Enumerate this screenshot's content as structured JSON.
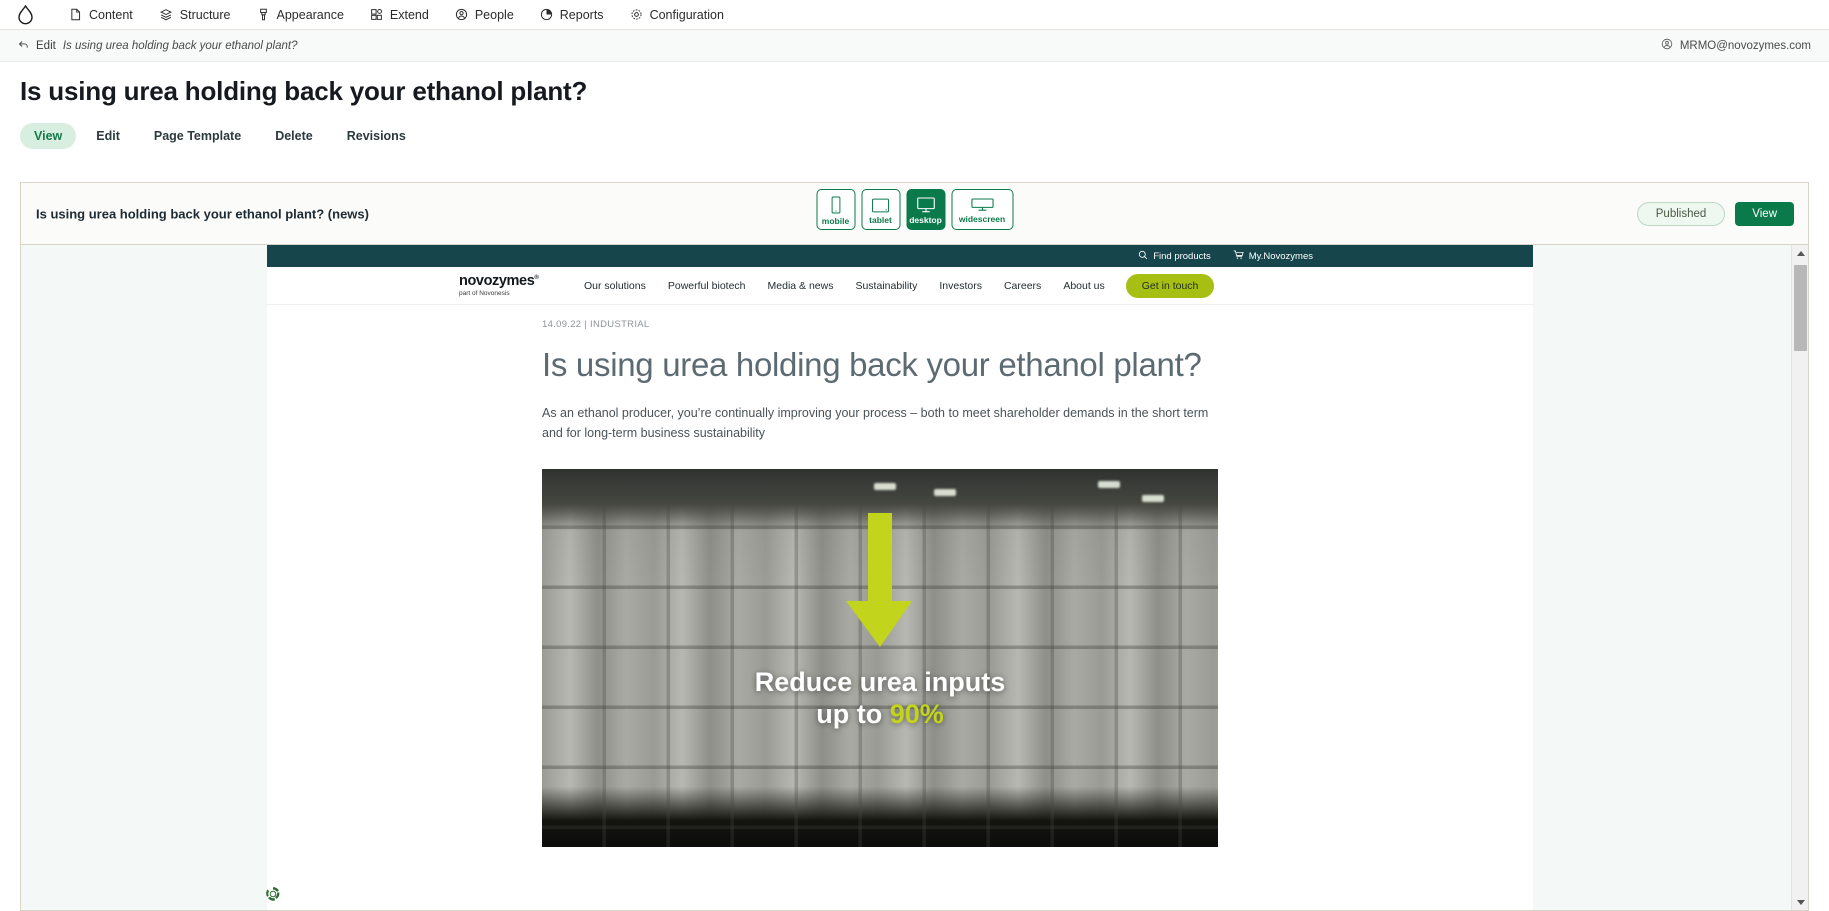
{
  "admin_toolbar": {
    "logo_name": "drupal-drop-logo",
    "items": [
      {
        "label": "Content",
        "icon": "file-icon"
      },
      {
        "label": "Structure",
        "icon": "layers-icon"
      },
      {
        "label": "Appearance",
        "icon": "paintbrush-icon"
      },
      {
        "label": "Extend",
        "icon": "puzzle-icon"
      },
      {
        "label": "People",
        "icon": "person-circle-icon"
      },
      {
        "label": "Reports",
        "icon": "pie-chart-icon"
      },
      {
        "label": "Configuration",
        "icon": "gear-icon"
      }
    ]
  },
  "edit_bar": {
    "back_icon": "back-arrow-icon",
    "edit_word": "Edit",
    "edit_title": "Is using urea holding back your ethanol plant?",
    "account_icon": "account-circle-icon",
    "account_email": "MRMO@novozymes.com"
  },
  "page": {
    "title": "Is using urea holding back your ethanol plant?",
    "tabs": [
      {
        "label": "View",
        "active": true
      },
      {
        "label": "Edit",
        "active": false
      },
      {
        "label": "Page Template",
        "active": false
      },
      {
        "label": "Delete",
        "active": false
      },
      {
        "label": "Revisions",
        "active": false
      }
    ]
  },
  "preview": {
    "label": "Is using urea holding back your ethanol plant? (news)",
    "devices": [
      {
        "label": "mobile",
        "icon": "phone-icon",
        "active": false
      },
      {
        "label": "tablet",
        "icon": "tablet-icon",
        "active": false
      },
      {
        "label": "desktop",
        "icon": "monitor-icon",
        "active": true
      },
      {
        "label": "widescreen",
        "icon": "widescreen-monitor-icon",
        "active": false
      }
    ],
    "status": "Published",
    "view_button": "View"
  },
  "site": {
    "utility_links": [
      {
        "label": "Find products",
        "icon": "search-icon"
      },
      {
        "label": "My.Novozymes",
        "icon": "cart-icon"
      }
    ],
    "logo": {
      "wordmark": "novozymes",
      "trademark": "®",
      "tagline": "part of Novonesis"
    },
    "nav": [
      "Our solutions",
      "Powerful biotech",
      "Media & news",
      "Sustainability",
      "Investors",
      "Careers",
      "About us"
    ],
    "cta": "Get in touch",
    "article": {
      "meta": "14.09.22 | INDUSTRIAL",
      "headline": "Is using urea holding back your ethanol plant?",
      "lede": "As an ethanol producer, you’re continually improving your process – both to meet shareholder demands in the short term and for long-term business sustainability",
      "hero": {
        "alt": "Stacked white bulk bags in a warehouse with a large green downward arrow",
        "overlay_line1": "Reduce urea inputs",
        "overlay_line2_prefix": "up to ",
        "overlay_line2_highlight": "90%"
      }
    },
    "cookie_icon": "recycle-cookie-settings-icon"
  },
  "colors": {
    "drupal_green": "#0b7a4b",
    "tab_active_bg": "#d7eee1",
    "novozymes_teal": "#16454c",
    "novozymes_lime": "#a7bf13",
    "hero_highlight": "#c3d41c"
  },
  "scrollbar": {
    "up_icon": "scroll-up-arrow-icon",
    "down_icon": "scroll-down-arrow-icon",
    "thumb": "scroll-thumb"
  }
}
